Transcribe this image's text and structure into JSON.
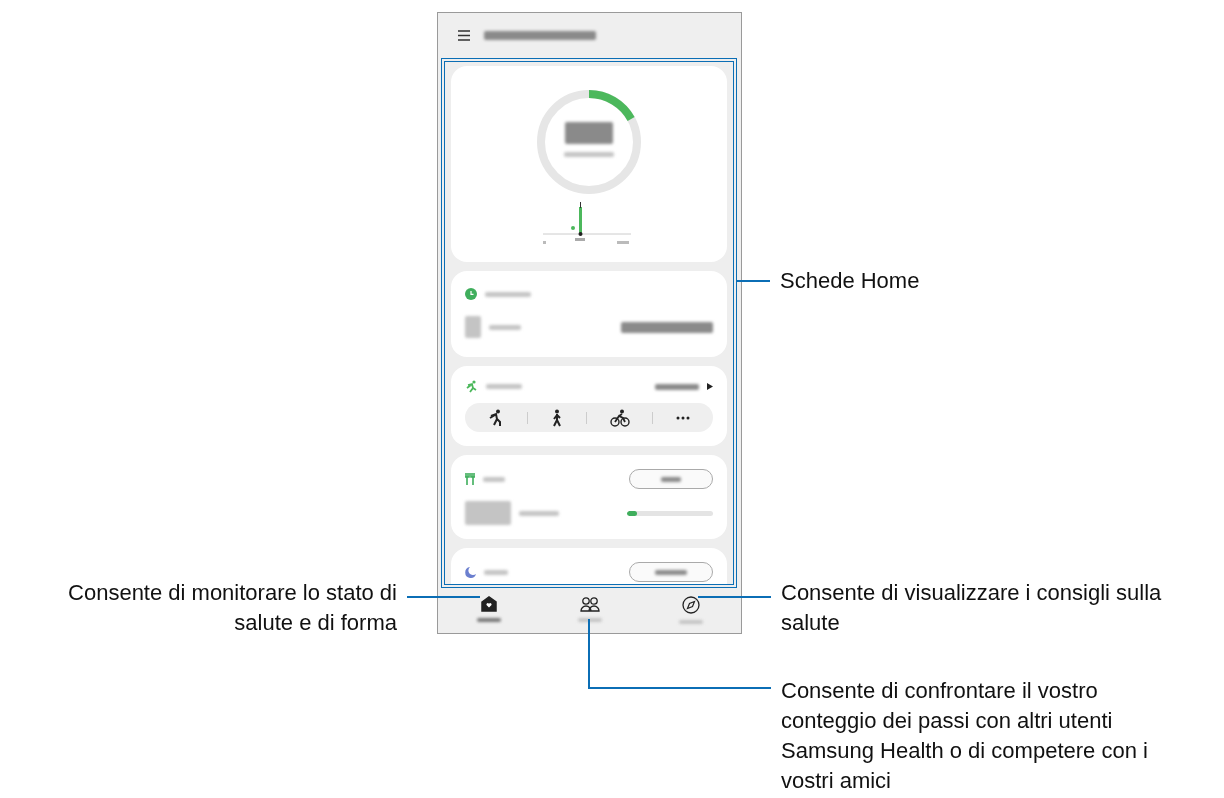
{
  "steps_ring": {
    "level": 0.17
  },
  "food": {
    "level": 0.12
  },
  "nav": [
    {
      "kind": "home",
      "selected": true
    },
    {
      "kind": "together",
      "selected": false
    },
    {
      "kind": "discover",
      "selected": false
    }
  ],
  "callouts": [
    {
      "kind": "cards",
      "lines": [
        "Schede Home"
      ]
    },
    {
      "kind": "home",
      "lines": [
        "Consente di monitorare lo stato di",
        "salute e di forma"
      ]
    },
    {
      "kind": "discover",
      "lines": [
        "Consente di visualizzare i consigli sulla",
        "salute"
      ]
    },
    {
      "kind": "together",
      "lines": [
        "Consente di confrontare il vostro",
        "conteggio dei passi con altri utenti",
        "Samsung Health o di competere con i",
        "vostri amici"
      ]
    }
  ]
}
